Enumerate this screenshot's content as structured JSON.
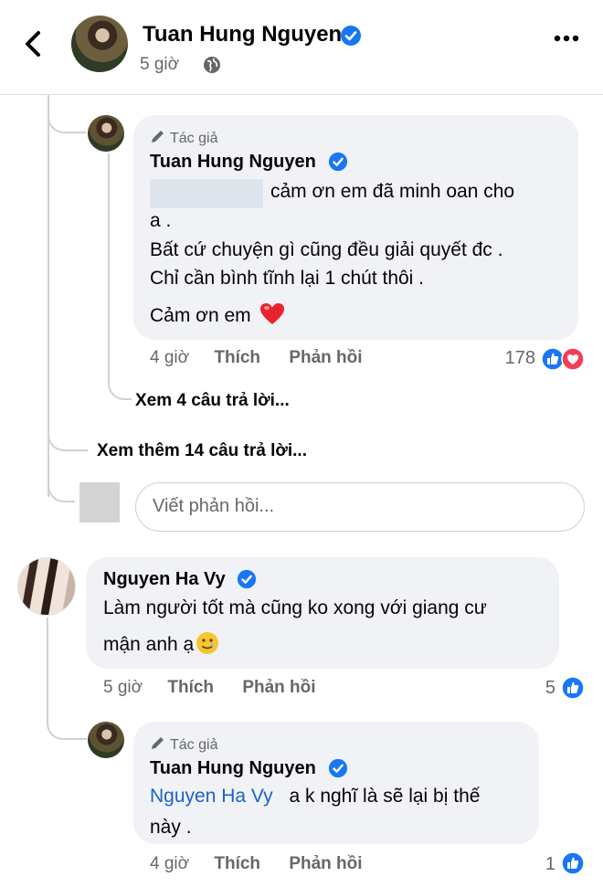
{
  "header": {
    "name": "Tuan Hung Nguyen",
    "time": "5 giờ"
  },
  "reply1": {
    "badge": "Tác giả",
    "name": "Tuan Hung Nguyen",
    "line1": "cảm ơn em đã minh oan cho",
    "line2": "a .",
    "line3": "Bất cứ chuyện gì cũng đều giải quyết đc .",
    "line4": "Chỉ cần bình tĩnh lại 1 chút thôi .",
    "line5": "Cảm ơn em",
    "emoji": "❤️",
    "time": "4 giờ",
    "like": "Thích",
    "reply": "Phản hồi",
    "reactions": "178"
  },
  "see_replies": "Xem 4 câu trả lời...",
  "see_more": "Xem thêm 14 câu trả lời...",
  "reply_placeholder": "Viết phản hồi...",
  "comment2": {
    "name": "Nguyen Ha Vy",
    "line1": "Làm người tốt mà cũng ko xong với giang cư",
    "line2": "mận anh ạ",
    "emoji": "🥲",
    "time": "5 giờ",
    "like": "Thích",
    "reply": "Phản hồi",
    "reactions": "5"
  },
  "reply2": {
    "badge": "Tác giả",
    "name": "Tuan Hung Nguyen",
    "mention": "Nguyen Ha Vy",
    "line1": "a k nghĩ là sẽ lại bị thế",
    "line2": "này .",
    "time": "4 giờ",
    "like": "Thích",
    "reply": "Phản hồi",
    "reactions": "1"
  },
  "colors": {
    "link_blue": "#1d62c8",
    "verified_blue": "#1877f2",
    "bubble_bg": "#f0f2f5",
    "meta_gray": "#65676b"
  },
  "icons": [
    "back-arrow-icon",
    "verified-icon",
    "globe-icon",
    "more-icon",
    "pen-icon",
    "like-reaction-icon",
    "love-reaction-icon"
  ]
}
